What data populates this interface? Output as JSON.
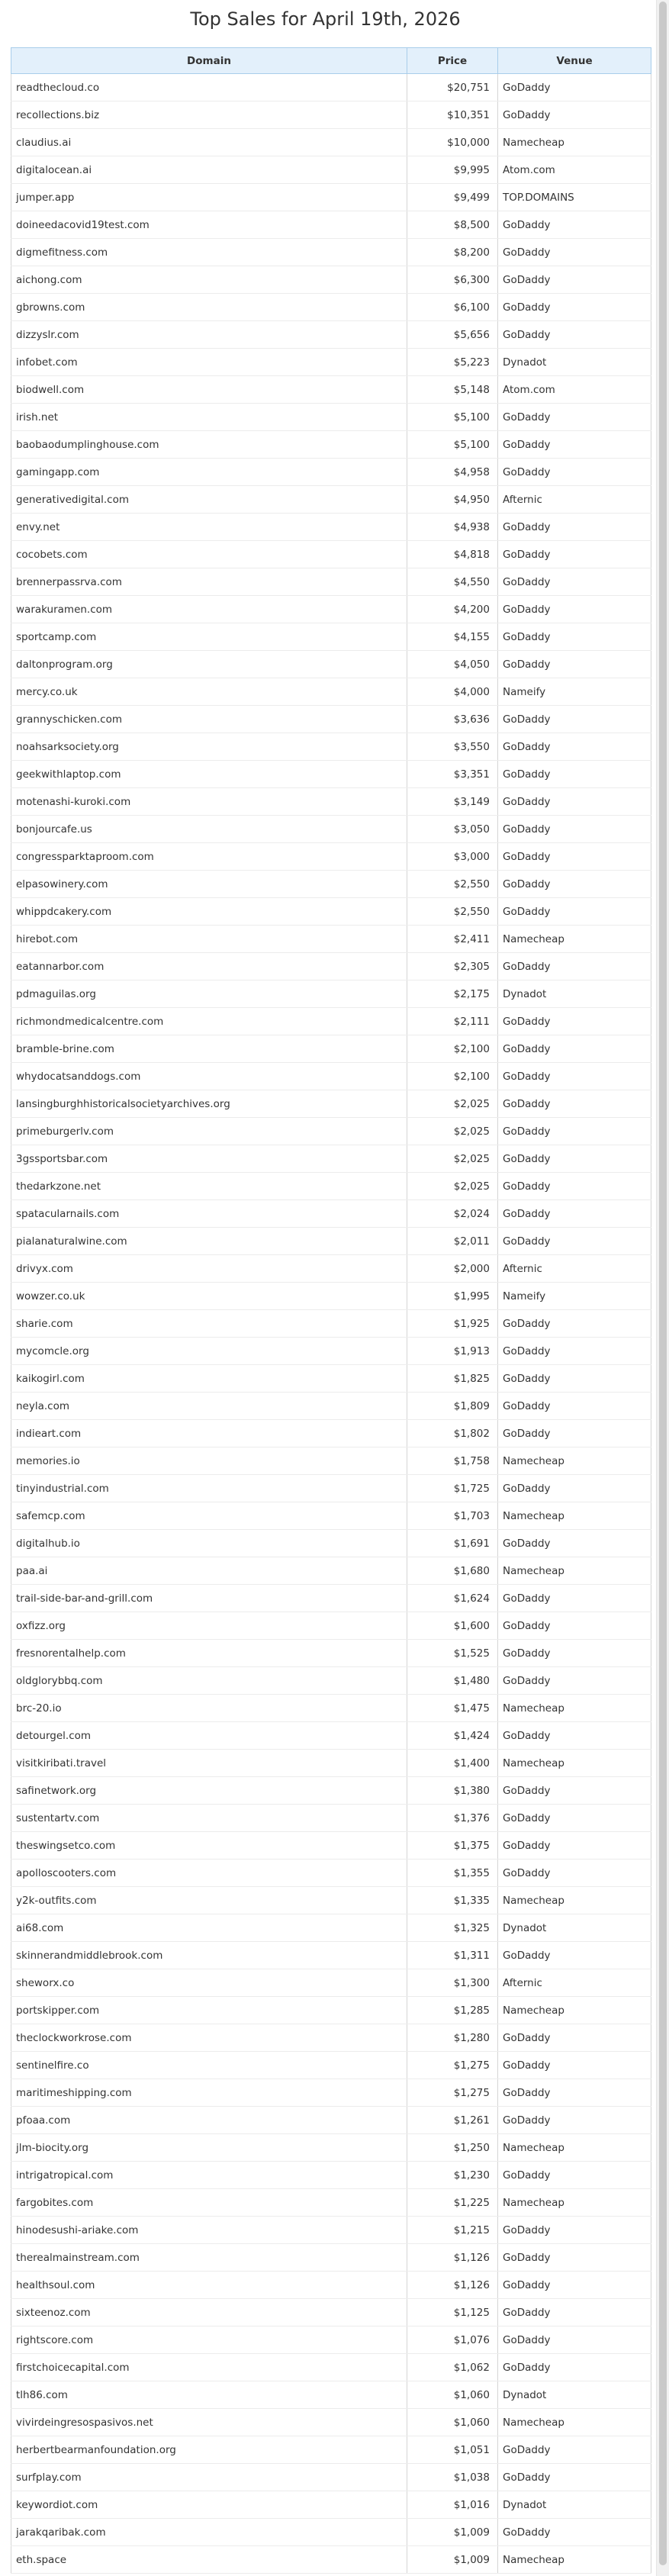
{
  "page": {
    "title": "Top Sales for April 19th, 2026"
  },
  "table": {
    "headers": {
      "domain": "Domain",
      "price": "Price",
      "venue": "Venue"
    },
    "rows": [
      {
        "domain": "readthecloud.co",
        "price": "$20,751",
        "venue": "GoDaddy"
      },
      {
        "domain": "recollections.biz",
        "price": "$10,351",
        "venue": "GoDaddy"
      },
      {
        "domain": "claudius.ai",
        "price": "$10,000",
        "venue": "Namecheap"
      },
      {
        "domain": "digitalocean.ai",
        "price": "$9,995",
        "venue": "Atom.com"
      },
      {
        "domain": "jumper.app",
        "price": "$9,499",
        "venue": "TOP.DOMAINS"
      },
      {
        "domain": "doineedacovid19test.com",
        "price": "$8,500",
        "venue": "GoDaddy"
      },
      {
        "domain": "digmefitness.com",
        "price": "$8,200",
        "venue": "GoDaddy"
      },
      {
        "domain": "aichong.com",
        "price": "$6,300",
        "venue": "GoDaddy"
      },
      {
        "domain": "gbrowns.com",
        "price": "$6,100",
        "venue": "GoDaddy"
      },
      {
        "domain": "dizzyslr.com",
        "price": "$5,656",
        "venue": "GoDaddy"
      },
      {
        "domain": "infobet.com",
        "price": "$5,223",
        "venue": "Dynadot"
      },
      {
        "domain": "biodwell.com",
        "price": "$5,148",
        "venue": "Atom.com"
      },
      {
        "domain": "irish.net",
        "price": "$5,100",
        "venue": "GoDaddy"
      },
      {
        "domain": "baobaodumplinghouse.com",
        "price": "$5,100",
        "venue": "GoDaddy"
      },
      {
        "domain": "gamingapp.com",
        "price": "$4,958",
        "venue": "GoDaddy"
      },
      {
        "domain": "generativedigital.com",
        "price": "$4,950",
        "venue": "Afternic"
      },
      {
        "domain": "envy.net",
        "price": "$4,938",
        "venue": "GoDaddy"
      },
      {
        "domain": "cocobets.com",
        "price": "$4,818",
        "venue": "GoDaddy"
      },
      {
        "domain": "brennerpassrva.com",
        "price": "$4,550",
        "venue": "GoDaddy"
      },
      {
        "domain": "warakuramen.com",
        "price": "$4,200",
        "venue": "GoDaddy"
      },
      {
        "domain": "sportcamp.com",
        "price": "$4,155",
        "venue": "GoDaddy"
      },
      {
        "domain": "daltonprogram.org",
        "price": "$4,050",
        "venue": "GoDaddy"
      },
      {
        "domain": "mercy.co.uk",
        "price": "$4,000",
        "venue": "Nameify"
      },
      {
        "domain": "grannyschicken.com",
        "price": "$3,636",
        "venue": "GoDaddy"
      },
      {
        "domain": "noahsarksociety.org",
        "price": "$3,550",
        "venue": "GoDaddy"
      },
      {
        "domain": "geekwithlaptop.com",
        "price": "$3,351",
        "venue": "GoDaddy"
      },
      {
        "domain": "motenashi-kuroki.com",
        "price": "$3,149",
        "venue": "GoDaddy"
      },
      {
        "domain": "bonjourcafe.us",
        "price": "$3,050",
        "venue": "GoDaddy"
      },
      {
        "domain": "congressparktaproom.com",
        "price": "$3,000",
        "venue": "GoDaddy"
      },
      {
        "domain": "elpasowinery.com",
        "price": "$2,550",
        "venue": "GoDaddy"
      },
      {
        "domain": "whippdcakery.com",
        "price": "$2,550",
        "venue": "GoDaddy"
      },
      {
        "domain": "hirebot.com",
        "price": "$2,411",
        "venue": "Namecheap"
      },
      {
        "domain": "eatannarbor.com",
        "price": "$2,305",
        "venue": "GoDaddy"
      },
      {
        "domain": "pdmaguilas.org",
        "price": "$2,175",
        "venue": "Dynadot"
      },
      {
        "domain": "richmondmedicalcentre.com",
        "price": "$2,111",
        "venue": "GoDaddy"
      },
      {
        "domain": "bramble-brine.com",
        "price": "$2,100",
        "venue": "GoDaddy"
      },
      {
        "domain": "whydocatsanddogs.com",
        "price": "$2,100",
        "venue": "GoDaddy"
      },
      {
        "domain": "lansingburghhistoricalsocietyarchives.org",
        "price": "$2,025",
        "venue": "GoDaddy"
      },
      {
        "domain": "primeburgerlv.com",
        "price": "$2,025",
        "venue": "GoDaddy"
      },
      {
        "domain": "3gssportsbar.com",
        "price": "$2,025",
        "venue": "GoDaddy"
      },
      {
        "domain": "thedarkzone.net",
        "price": "$2,025",
        "venue": "GoDaddy"
      },
      {
        "domain": "spatacularnails.com",
        "price": "$2,024",
        "venue": "GoDaddy"
      },
      {
        "domain": "pialanaturalwine.com",
        "price": "$2,011",
        "venue": "GoDaddy"
      },
      {
        "domain": "drivyx.com",
        "price": "$2,000",
        "venue": "Afternic"
      },
      {
        "domain": "wowzer.co.uk",
        "price": "$1,995",
        "venue": "Nameify"
      },
      {
        "domain": "sharie.com",
        "price": "$1,925",
        "venue": "GoDaddy"
      },
      {
        "domain": "mycomcle.org",
        "price": "$1,913",
        "venue": "GoDaddy"
      },
      {
        "domain": "kaikogirl.com",
        "price": "$1,825",
        "venue": "GoDaddy"
      },
      {
        "domain": "neyla.com",
        "price": "$1,809",
        "venue": "GoDaddy"
      },
      {
        "domain": "indieart.com",
        "price": "$1,802",
        "venue": "GoDaddy"
      },
      {
        "domain": "memories.io",
        "price": "$1,758",
        "venue": "Namecheap"
      },
      {
        "domain": "tinyindustrial.com",
        "price": "$1,725",
        "venue": "GoDaddy"
      },
      {
        "domain": "safemcp.com",
        "price": "$1,703",
        "venue": "Namecheap"
      },
      {
        "domain": "digitalhub.io",
        "price": "$1,691",
        "venue": "GoDaddy"
      },
      {
        "domain": "paa.ai",
        "price": "$1,680",
        "venue": "Namecheap"
      },
      {
        "domain": "trail-side-bar-and-grill.com",
        "price": "$1,624",
        "venue": "GoDaddy"
      },
      {
        "domain": "oxfizz.org",
        "price": "$1,600",
        "venue": "GoDaddy"
      },
      {
        "domain": "fresnorentalhelp.com",
        "price": "$1,525",
        "venue": "GoDaddy"
      },
      {
        "domain": "oldglorybbq.com",
        "price": "$1,480",
        "venue": "GoDaddy"
      },
      {
        "domain": "brc-20.io",
        "price": "$1,475",
        "venue": "Namecheap"
      },
      {
        "domain": "detourgel.com",
        "price": "$1,424",
        "venue": "GoDaddy"
      },
      {
        "domain": "visitkiribati.travel",
        "price": "$1,400",
        "venue": "Namecheap"
      },
      {
        "domain": "safinetwork.org",
        "price": "$1,380",
        "venue": "GoDaddy"
      },
      {
        "domain": "sustentartv.com",
        "price": "$1,376",
        "venue": "GoDaddy"
      },
      {
        "domain": "theswingsetco.com",
        "price": "$1,375",
        "venue": "GoDaddy"
      },
      {
        "domain": "apolloscooters.com",
        "price": "$1,355",
        "venue": "GoDaddy"
      },
      {
        "domain": "y2k-outfits.com",
        "price": "$1,335",
        "venue": "Namecheap"
      },
      {
        "domain": "ai68.com",
        "price": "$1,325",
        "venue": "Dynadot"
      },
      {
        "domain": "skinnerandmiddlebrook.com",
        "price": "$1,311",
        "venue": "GoDaddy"
      },
      {
        "domain": "sheworx.co",
        "price": "$1,300",
        "venue": "Afternic"
      },
      {
        "domain": "portskipper.com",
        "price": "$1,285",
        "venue": "Namecheap"
      },
      {
        "domain": "theclockworkrose.com",
        "price": "$1,280",
        "venue": "GoDaddy"
      },
      {
        "domain": "sentinelfire.co",
        "price": "$1,275",
        "venue": "GoDaddy"
      },
      {
        "domain": "maritimeshipping.com",
        "price": "$1,275",
        "venue": "GoDaddy"
      },
      {
        "domain": "pfoaa.com",
        "price": "$1,261",
        "venue": "GoDaddy"
      },
      {
        "domain": "jlm-biocity.org",
        "price": "$1,250",
        "venue": "Namecheap"
      },
      {
        "domain": "intrigatropical.com",
        "price": "$1,230",
        "venue": "GoDaddy"
      },
      {
        "domain": "fargobites.com",
        "price": "$1,225",
        "venue": "Namecheap"
      },
      {
        "domain": "hinodesushi-ariake.com",
        "price": "$1,215",
        "venue": "GoDaddy"
      },
      {
        "domain": "therealmainstream.com",
        "price": "$1,126",
        "venue": "GoDaddy"
      },
      {
        "domain": "healthsoul.com",
        "price": "$1,126",
        "venue": "GoDaddy"
      },
      {
        "domain": "sixteenoz.com",
        "price": "$1,125",
        "venue": "GoDaddy"
      },
      {
        "domain": "rightscore.com",
        "price": "$1,076",
        "venue": "GoDaddy"
      },
      {
        "domain": "firstchoicecapital.com",
        "price": "$1,062",
        "venue": "GoDaddy"
      },
      {
        "domain": "tlh86.com",
        "price": "$1,060",
        "venue": "Dynadot"
      },
      {
        "domain": "vivirdeingresospasivos.net",
        "price": "$1,060",
        "venue": "Namecheap"
      },
      {
        "domain": "herbertbearmanfoundation.org",
        "price": "$1,051",
        "venue": "GoDaddy"
      },
      {
        "domain": "surfplay.com",
        "price": "$1,038",
        "venue": "GoDaddy"
      },
      {
        "domain": "keywordiot.com",
        "price": "$1,016",
        "venue": "Dynadot"
      },
      {
        "domain": "jarakqaribak.com",
        "price": "$1,009",
        "venue": "GoDaddy"
      },
      {
        "domain": "eth.space",
        "price": "$1,009",
        "venue": "Namecheap"
      }
    ]
  },
  "colors": {
    "header_bg": "#e3f0fb",
    "header_border": "#a9cdea",
    "text": "#333333"
  }
}
